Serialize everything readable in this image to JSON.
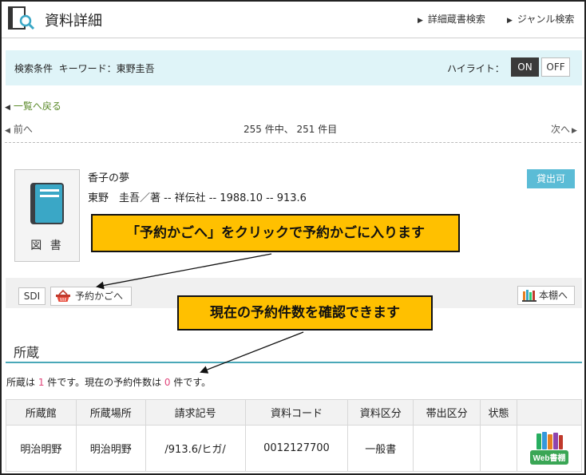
{
  "header": {
    "title": "資料詳細",
    "links": [
      "詳細蔵書検索",
      "ジャンル検索"
    ]
  },
  "condition": {
    "text": "検索条件  キーワード：東野圭吾",
    "highlight_label": "ハイライト：",
    "on_label": "ON",
    "off_label": "OFF"
  },
  "nav": {
    "back": "一覧へ戻る",
    "prev": "前へ",
    "count": "255 件中、 251 件目",
    "next": "次へ"
  },
  "record": {
    "type_label": "図 書",
    "title": "香子の夢",
    "meta": "東野　圭吾／著 -- 祥伝社 -- 1988.10 -- 913.6",
    "status": "貸出可"
  },
  "actions": {
    "sdi": "SDI",
    "cart": "予約かごへ",
    "shelf": "本棚へ"
  },
  "callouts": {
    "cart_note": "「予約かごへ」をクリックで予約かごに入ります",
    "count_note": "現在の予約件数を確認できます"
  },
  "holdings": {
    "title": "所蔵",
    "summary_pre": "所蔵は ",
    "holding_count": "1",
    "summary_mid": " 件です。現在の予約件数は ",
    "reserve_count": "0",
    "summary_post": " 件です。",
    "columns": [
      "所蔵館",
      "所蔵場所",
      "請求記号",
      "資料コード",
      "資料区分",
      "帯出区分",
      "状態",
      ""
    ],
    "rows": [
      {
        "library": "明治明野",
        "location": "明治明野",
        "call_no": "/913.6/ヒガ/",
        "code": "0012127700",
        "category": "一般書",
        "loan": "",
        "state": "",
        "web_label": "Web書棚"
      }
    ]
  },
  "colors": {
    "accent_cyan": "#5bbcd6",
    "callout_yellow": "#ffc000",
    "condition_bg": "#dff4f8",
    "count_red": "#e0457b"
  }
}
